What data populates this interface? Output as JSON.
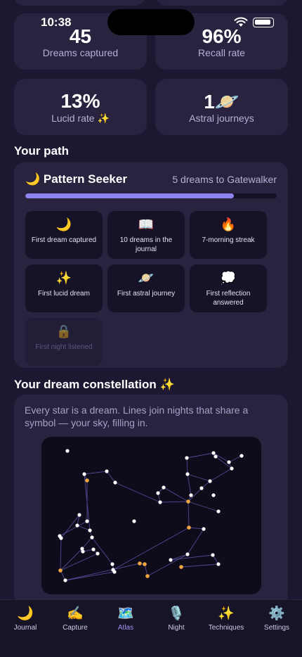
{
  "status_bar": {
    "time": "10:38"
  },
  "stats": [
    {
      "value": "45",
      "label": "Dreams captured"
    },
    {
      "value": "96%",
      "label": "Recall rate"
    },
    {
      "value": "13%",
      "label": "Lucid rate ✨"
    },
    {
      "value": "1🪐",
      "label": "Astral journeys"
    }
  ],
  "path": {
    "section_title": "Your path",
    "level_title": "🌙 Pattern Seeker",
    "next_level_text": "5 dreams to Gatewalker",
    "progress_fraction": 0.83,
    "colors": {
      "progress": "#8d84f0"
    },
    "badges": [
      {
        "icon": "🌙",
        "label": "First dream captured",
        "unlocked": true
      },
      {
        "icon": "📖",
        "label": "10 dreams in the journal",
        "unlocked": true
      },
      {
        "icon": "🔥",
        "label": "7-morning streak",
        "unlocked": true
      },
      {
        "icon": "✨",
        "label": "First lucid dream",
        "unlocked": true
      },
      {
        "icon": "🪐",
        "label": "First astral journey",
        "unlocked": true
      },
      {
        "icon": "💭",
        "label": "First reflection answered",
        "unlocked": true
      },
      {
        "icon": "🔒",
        "label": "First night listened",
        "unlocked": false
      }
    ]
  },
  "constellation": {
    "section_title": "Your dream constellation ✨",
    "description": "Every star is a dream. Lines join nights that share a symbol — your sky, filling in.",
    "colors": {
      "star": "#ffffff",
      "star_highlight": "#f0a640",
      "line": "#5a55a8"
    }
  },
  "tabs": [
    {
      "icon": "🌙",
      "label": "Journal",
      "active": false
    },
    {
      "icon": "✍️",
      "label": "Capture",
      "active": false
    },
    {
      "icon": "🗺️",
      "label": "Atlas",
      "active": true
    },
    {
      "icon": "🎙️",
      "label": "Night",
      "active": false
    },
    {
      "icon": "✨",
      "label": "Techniques",
      "active": false
    },
    {
      "icon": "⚙️",
      "label": "Settings",
      "active": false
    }
  ]
}
